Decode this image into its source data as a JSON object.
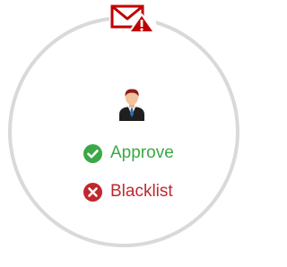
{
  "header_icon": {
    "name": "mail-warning-icon",
    "color": "#c00000"
  },
  "user_icon": {
    "name": "user-avatar-icon"
  },
  "options": {
    "approve": {
      "label": "Approve",
      "icon": "check-circle-icon",
      "color": "#3aa845"
    },
    "blacklist": {
      "label": "Blacklist",
      "icon": "x-circle-icon",
      "color": "#c0282d"
    }
  },
  "ring_color": "#d9d9d9"
}
